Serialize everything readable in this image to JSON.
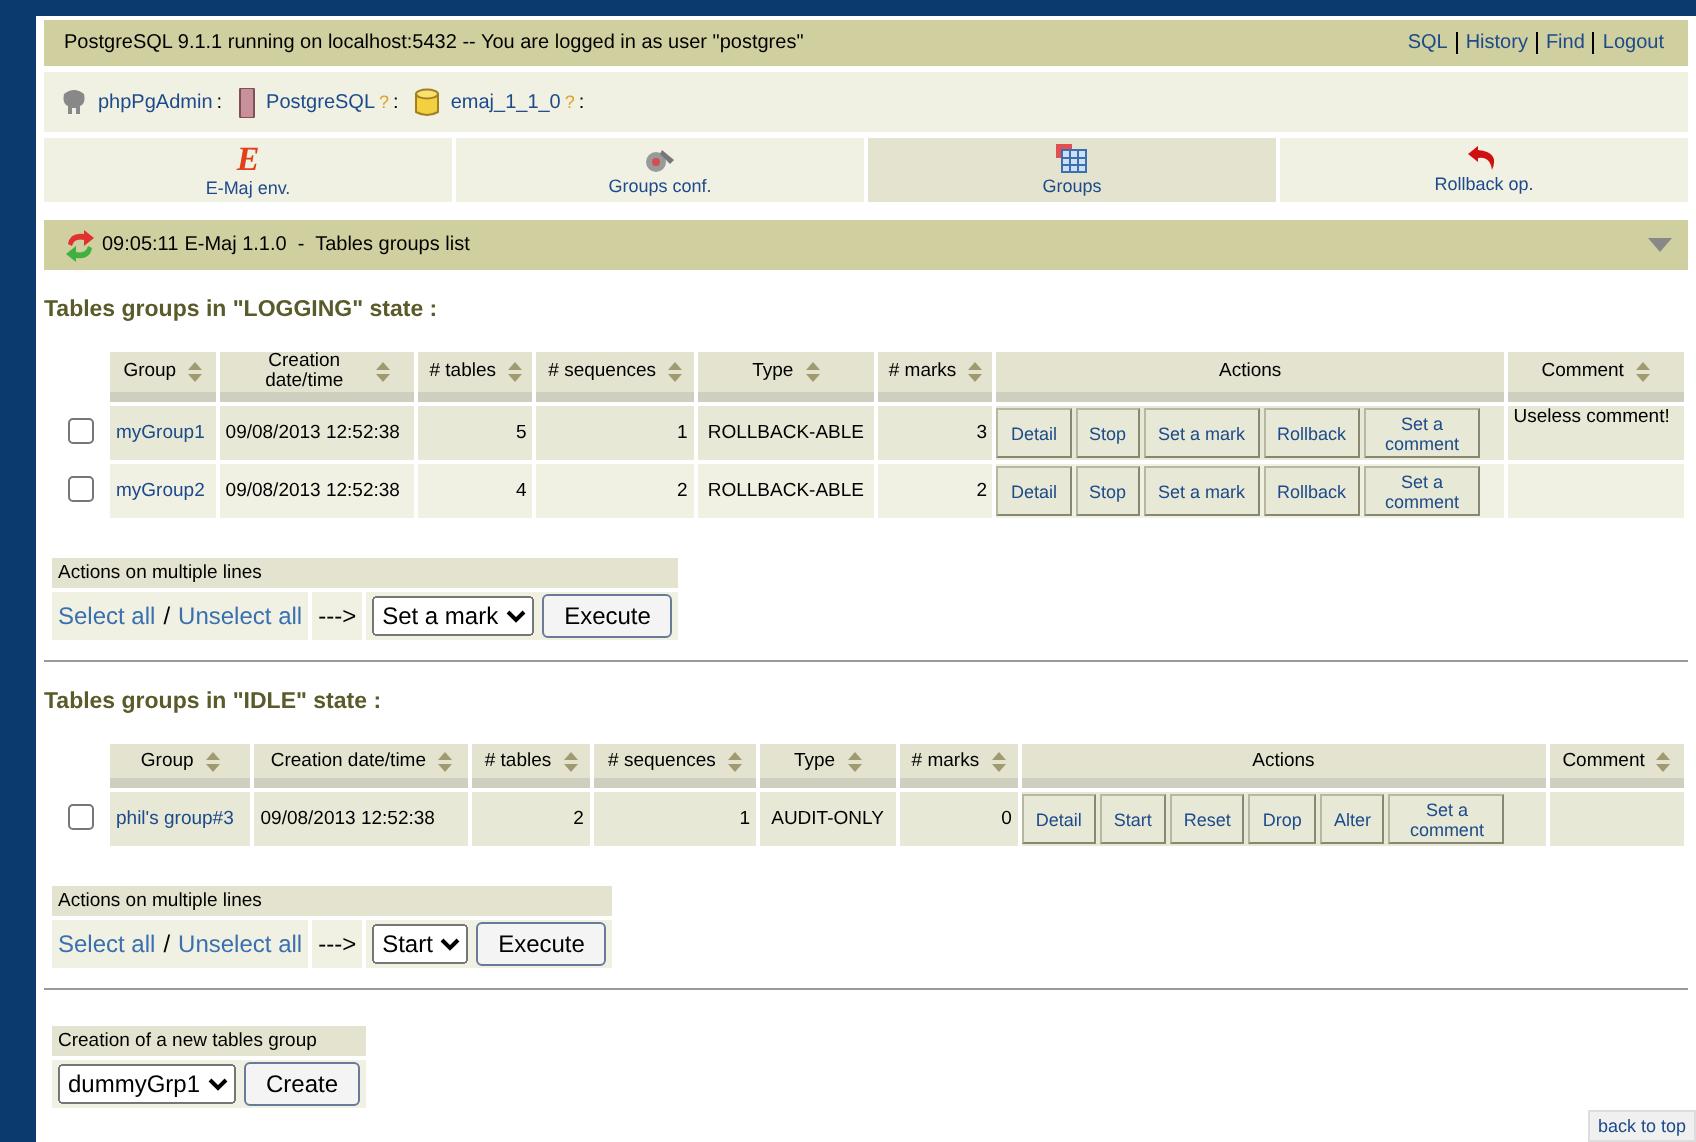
{
  "top_bar": {
    "server_info": "PostgreSQL 9.1.1 running on localhost:5432 -- You are logged in as user \"postgres\"",
    "links": [
      "SQL",
      "History",
      "Find",
      "Logout"
    ]
  },
  "breadcrumb": [
    {
      "kind": "server",
      "label": "phpPgAdmin",
      "separator": ":"
    },
    {
      "kind": "database",
      "label": "PostgreSQL",
      "help": "?",
      "separator": ":"
    },
    {
      "kind": "schema",
      "label": "emaj_1_1_0",
      "help": "?",
      "separator": ":"
    }
  ],
  "tabs": [
    {
      "kind": "emaj",
      "glyph": "E",
      "label": "E-Maj env.",
      "selected": false
    },
    {
      "kind": "config",
      "label": "Groups conf.",
      "selected": false
    },
    {
      "kind": "groups",
      "label": "Groups",
      "selected": true
    },
    {
      "kind": "rollback",
      "label": "Rollback op.",
      "selected": false
    }
  ],
  "section_bar": {
    "time": "09:05:11",
    "title": "E-Maj 1.1.0  -  Tables groups list"
  },
  "sections": [
    {
      "title": "Tables groups in \"LOGGING\" state :",
      "columns": [
        {
          "label": "Group",
          "sortable": true
        },
        {
          "label": "Creation date/time",
          "sortable": true,
          "wrap": true
        },
        {
          "label": "# tables",
          "sortable": true,
          "wrap": true
        },
        {
          "label": "# sequences",
          "sortable": true,
          "wrap": true
        },
        {
          "label": "Type",
          "sortable": true
        },
        {
          "label": "# marks",
          "sortable": true,
          "wrap": true
        },
        {
          "label": "Actions",
          "sortable": false
        },
        {
          "label": "Comment",
          "sortable": true
        }
      ],
      "rows": [
        {
          "checked": false,
          "group": "myGroup1",
          "created": "09/08/2013 12:52:38",
          "tables": "5",
          "sequences": "1",
          "type": "ROLLBACK-ABLE",
          "marks": "3",
          "actions": [
            "Detail",
            "Stop",
            "Set a mark",
            "Rollback",
            "Set a comment"
          ],
          "comment": "Useless comment!"
        },
        {
          "checked": false,
          "group": "myGroup2",
          "created": "09/08/2013 12:52:38",
          "tables": "4",
          "sequences": "2",
          "type": "ROLLBACK-ABLE",
          "marks": "2",
          "actions": [
            "Detail",
            "Stop",
            "Set a mark",
            "Rollback",
            "Set a comment"
          ],
          "comment": ""
        }
      ],
      "multi": {
        "title": "Actions on multiple lines",
        "select_all": "Select all",
        "slash": "/",
        "unselect_all": "Unselect all",
        "arrow": "--->",
        "action": "Set a mark",
        "button": "Execute"
      }
    },
    {
      "title": "Tables groups in \"IDLE\" state :",
      "columns": [
        {
          "label": "Group",
          "sortable": true
        },
        {
          "label": "Creation date/time",
          "sortable": true
        },
        {
          "label": "# tables",
          "sortable": true
        },
        {
          "label": "# sequences",
          "sortable": true
        },
        {
          "label": "Type",
          "sortable": true
        },
        {
          "label": "# marks",
          "sortable": true
        },
        {
          "label": "Actions",
          "sortable": false
        },
        {
          "label": "Comment",
          "sortable": true
        }
      ],
      "rows": [
        {
          "checked": false,
          "group": "phil's group#3",
          "created": "09/08/2013 12:52:38",
          "tables": "2",
          "sequences": "1",
          "type": "AUDIT-ONLY",
          "marks": "0",
          "actions": [
            "Detail",
            "Start",
            "Reset",
            "Drop",
            "Alter",
            "Set a comment"
          ],
          "comment": ""
        }
      ],
      "multi": {
        "title": "Actions on multiple lines",
        "select_all": "Select all",
        "slash": "/",
        "unselect_all": "Unselect all",
        "arrow": "--->",
        "action": "Start",
        "button": "Execute"
      }
    }
  ],
  "create": {
    "title": "Creation of a new tables group",
    "value": "dummyGrp1",
    "button": "Create"
  },
  "back_to_top": "back to top"
}
